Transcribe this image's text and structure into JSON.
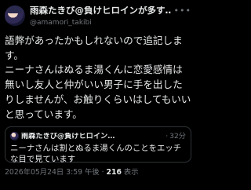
{
  "post": {
    "author": {
      "display_name": "雨森たきび@負けヒロインが多す…",
      "handle": "@amamori_takibi",
      "avatar_icon": "avatar-image"
    },
    "more_icon": "more-options-icon",
    "text": "語弊があったかもしれないので追記します。\nニーナさんはぬるま湯くんに恋愛感情は無いし友人と仲がいい男子に手を出したりしませんが、お触りくらいはしてもいいと思っています。",
    "quote": {
      "author_name": "雨森たきび@負けヒロイン…",
      "separator": "·",
      "time": "32分",
      "text": "ニーナさんは割とぬるま湯くんのことをエッチな目で見ています"
    },
    "meta": {
      "timestamp": "2026年05月24日 3:59 午後",
      "separator": "·",
      "views_count": "216",
      "views_label": "表示"
    }
  },
  "colors": {
    "background": "#000000",
    "text_primary": "#e7e9ea",
    "text_secondary": "#71767b",
    "border": "#2f3336"
  }
}
